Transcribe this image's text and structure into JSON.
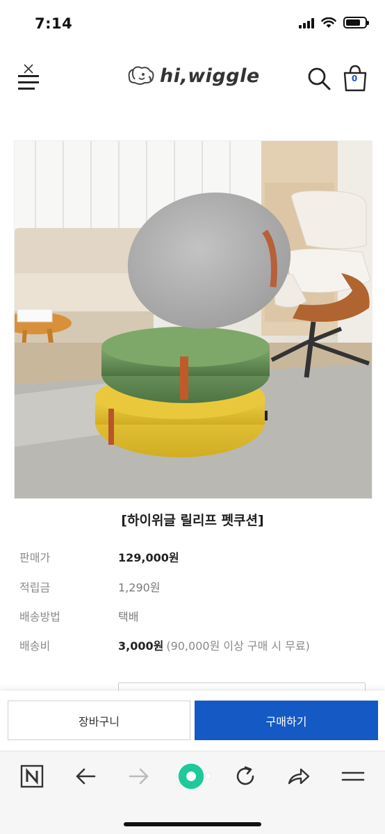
{
  "status_bar": {
    "time": "7:14",
    "battery_level": 0.75
  },
  "header": {
    "brand": "hi,wiggle",
    "menu_icon": "hamburger-menu-icon",
    "search_icon": "search-icon",
    "cart_icon": "shopping-bag-icon",
    "cart_count": "0"
  },
  "product": {
    "title": "[하이위글 릴리프 펫쿠션]",
    "info": [
      {
        "label": "판매가",
        "value": "129,000원",
        "note": ""
      },
      {
        "label": "적립금",
        "value": "1,290원",
        "note": ""
      },
      {
        "label": "배송방법",
        "value": "택배",
        "note": ""
      },
      {
        "label": "배송비",
        "value": "3,000원",
        "note": "(90,000원 이상 구매 시 무료)"
      }
    ]
  },
  "actions": {
    "cart_label": "장바구니",
    "buy_label": "구매하기"
  },
  "colors": {
    "primary": "#1559c5",
    "cart_badge": "#1a56c4",
    "refresh_green": "#1ec99a"
  },
  "browser_toolbar": {
    "items": [
      "naver-home-icon",
      "back-arrow-icon",
      "forward-arrow-icon",
      "green-dot-icon",
      "refresh-icon",
      "share-icon",
      "menu-icon"
    ]
  }
}
